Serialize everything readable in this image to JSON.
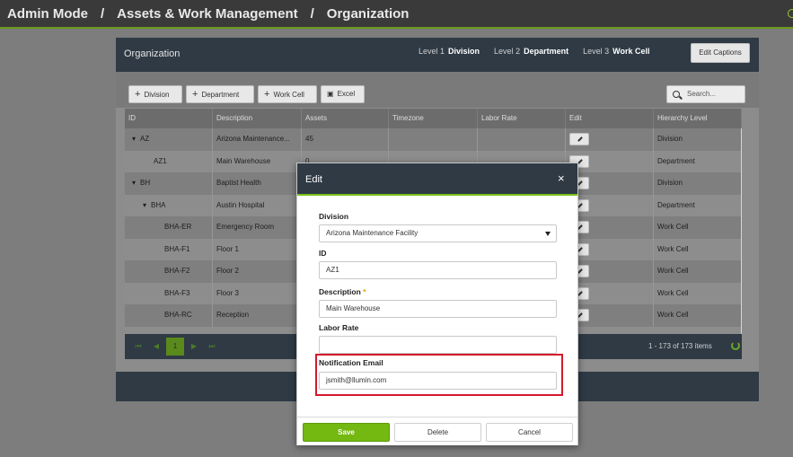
{
  "header": {
    "crumbs": [
      "Admin Mode",
      "Assets & Work Management",
      "Organization"
    ],
    "separator": "/"
  },
  "panel": {
    "title": "Organization",
    "levels": [
      {
        "label": "Level 1",
        "value": "Division"
      },
      {
        "label": "Level 2",
        "value": "Department"
      },
      {
        "label": "Level 3",
        "value": "Work Cell"
      }
    ],
    "edit_captions": "Edit Captions"
  },
  "toolbar": {
    "add_division": "Division",
    "add_department": "Department",
    "add_work_cell": "Work Cell",
    "excel": "Excel",
    "search_placeholder": "Search..."
  },
  "grid": {
    "columns": [
      "ID",
      "Description",
      "Assets",
      "Timezone",
      "Labor Rate",
      "Edit",
      "Hierarchy Level"
    ],
    "rows": [
      {
        "id": "AZ",
        "expand": "▾",
        "indent": 0,
        "description": "Arizona Maintenance...",
        "assets": "45",
        "level": "Division"
      },
      {
        "id": "AZ1",
        "expand": "",
        "indent": 1,
        "description": "Main Warehouse",
        "assets": "0",
        "level": "Department"
      },
      {
        "id": "BH",
        "expand": "▾",
        "indent": 0,
        "description": "Baptist Health",
        "assets": "",
        "level": "Division"
      },
      {
        "id": "BHA",
        "expand": "▾",
        "indent": 1,
        "description": "Austin Hospital",
        "assets": "",
        "level": "Department"
      },
      {
        "id": "BHA-ER",
        "expand": "",
        "indent": 2,
        "description": "Emergency Room",
        "assets": "",
        "level": "Work Cell"
      },
      {
        "id": "BHA-F1",
        "expand": "",
        "indent": 2,
        "description": "Floor 1",
        "assets": "",
        "level": "Work Cell"
      },
      {
        "id": "BHA-F2",
        "expand": "",
        "indent": 2,
        "description": "Floor 2",
        "assets": "",
        "level": "Work Cell"
      },
      {
        "id": "BHA-F3",
        "expand": "",
        "indent": 2,
        "description": "Floor 3",
        "assets": "",
        "level": "Work Cell"
      },
      {
        "id": "BHA-RC",
        "expand": "",
        "indent": 2,
        "description": "Reception",
        "assets": "",
        "level": "Work Cell"
      }
    ]
  },
  "pager": {
    "first": "⏮",
    "prev": "◀",
    "current": "1",
    "next": "▶",
    "last": "⏭",
    "items": "1 - 173 of 173 items"
  },
  "modal": {
    "title": "Edit",
    "close": "×",
    "division_label": "Division",
    "division_value": "Arizona Maintenance Facility",
    "id_label": "ID",
    "id_value": "AZ1",
    "description_label": "Description",
    "required_mark": "*",
    "description_value": "Main Warehouse",
    "labor_rate_label": "Labor Rate",
    "labor_rate_value": "",
    "email_label": "Notification Email",
    "email_value": "jsmith@llumin.com",
    "save": "Save",
    "delete": "Delete",
    "cancel": "Cancel"
  },
  "colors": {
    "accent_green": "#74b812",
    "header_dark": "#2f3a45",
    "highlight_red": "#d5192a"
  }
}
